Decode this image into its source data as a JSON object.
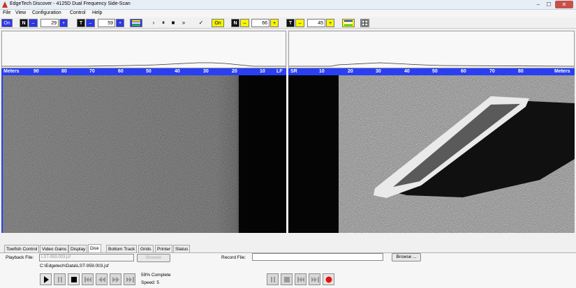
{
  "window": {
    "title": "EdgeTech  Discover - 4125D  Dual Frequency Side-Scan",
    "minimize": "–",
    "maximize": "☐",
    "close": "✕"
  },
  "menu": [
    "File",
    "View",
    "Configuration",
    "Control",
    "Help"
  ],
  "toolbar": {
    "left": {
      "on": "On",
      "n": "N",
      "n_minus": "–",
      "n_value": "29",
      "n_plus": "+",
      "t": "T",
      "t_minus": "–",
      "t_value": "59",
      "t_plus": "+"
    },
    "playback": {
      "play": "›",
      "pause": "⏸",
      "stop": "■",
      "fast_forward": "»",
      "check": "✓"
    },
    "right": {
      "on": "On",
      "n": "N",
      "n_minus": "–",
      "n_value": "66",
      "n_plus": "+",
      "t": "T",
      "t_minus": "–",
      "t_value": "45",
      "t_plus": "+"
    }
  },
  "rulers": {
    "left": {
      "unit": "Meters",
      "ticks": [
        "90",
        "80",
        "70",
        "60",
        "50",
        "40",
        "30",
        "20",
        "10"
      ],
      "channel": "LF"
    },
    "right": {
      "channel": "SR",
      "ticks": [
        "10",
        "20",
        "30",
        "40",
        "50",
        "60",
        "70",
        "80"
      ],
      "unit": "Meters"
    }
  },
  "tabs": [
    "Towfish Control",
    "Video Gains",
    "Display",
    "Disk",
    "Bottom Track",
    "Grids",
    "Printer",
    "Status"
  ],
  "active_tab": "Disk",
  "disk": {
    "playback_label": "Playback File:",
    "playback_value": "LST-959.003.jsf",
    "browse_playback": "Browse",
    "playback_path": "C:\\Edgetech\\Data\\LST-959.003.jsf",
    "progress_text": "59% Complete",
    "progress": 0.59,
    "speed_text": "Speed: 5",
    "record_label": "Record File:",
    "record_value": "",
    "browse_record": "Browse ..."
  },
  "colors": {
    "ruler_blue": "#2a3ff2",
    "toolbar_yellow": "#f6f500",
    "record_red": "#e81010"
  }
}
